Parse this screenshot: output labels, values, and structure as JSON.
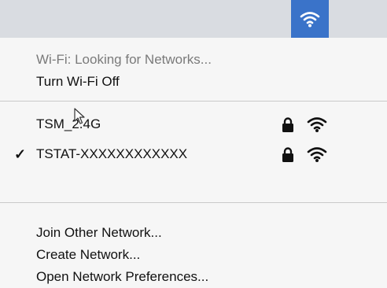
{
  "menubar": {
    "wifi_icon": "wifi-icon",
    "wifi_icon_bg": "#3a73c9"
  },
  "menu": {
    "status": "Wi-Fi: Looking for Networks...",
    "toggle": "Turn Wi-Fi Off",
    "networks": [
      {
        "name": "TSM_2.4G",
        "connected": false,
        "secured": true,
        "icons": [
          "lock-icon",
          "wifi-signal-icon"
        ]
      },
      {
        "name": "TSTAT-XXXXXXXXXXXX",
        "connected": true,
        "check": "✓",
        "secured": true,
        "icons": [
          "lock-icon",
          "wifi-signal-icon"
        ]
      }
    ],
    "actions": {
      "join": "Join Other Network...",
      "create": "Create Network...",
      "prefs": "Open Network Preferences..."
    }
  }
}
